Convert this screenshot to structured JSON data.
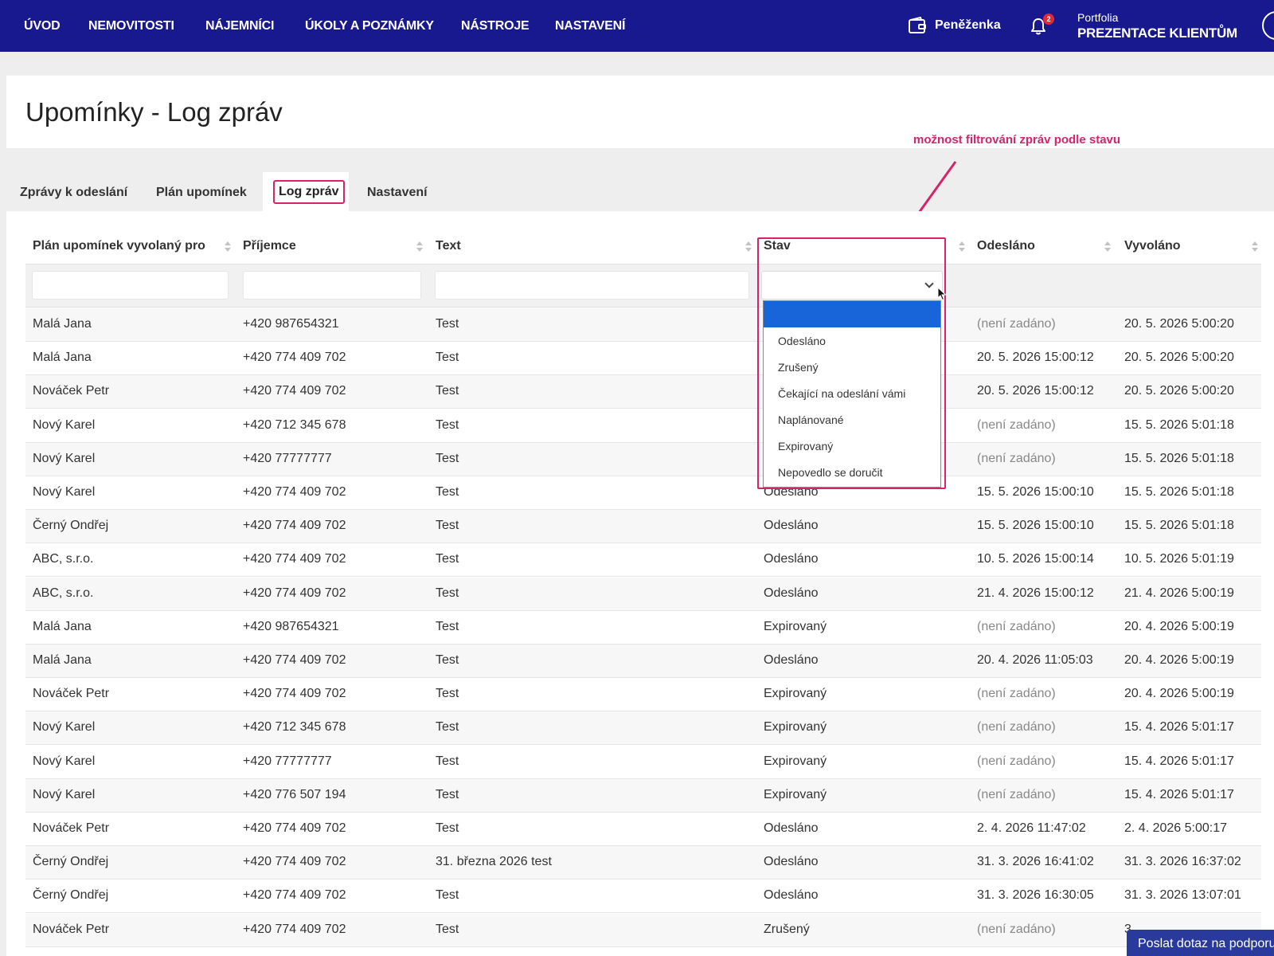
{
  "nav": {
    "items": [
      "ÚVOD",
      "NEMOVITOSTI",
      "NÁJEMNÍCI",
      "ÚKOLY A POZNÁMKY",
      "NÁSTROJE",
      "NASTAVENÍ"
    ],
    "wallet_label": "Peněženka",
    "notification_count": "2",
    "portfolio_label": "Portfolia",
    "portfolio_name": "PREZENTACE KLIENTŮM"
  },
  "page": {
    "title": "Upomínky - Log zpráv"
  },
  "annotation": {
    "text": "možnost filtrování zpráv podle stavu"
  },
  "tabs": [
    "Zprávy k odeslání",
    "Plán upomínek",
    "Log zpráv",
    "Nastavení"
  ],
  "active_tab": "Log zpráv",
  "table": {
    "columns": [
      "Plán upomínek vyvolaný pro",
      "Příjemce",
      "Text",
      "Stav",
      "Odesláno",
      "Vyvoláno"
    ],
    "rows": [
      [
        "Malá Jana",
        "+420 987654321",
        "Test",
        "",
        "(není zadáno)",
        "20. 5. 2026 5:00:20"
      ],
      [
        "Malá Jana",
        "+420 774 409 702",
        "Test",
        "",
        "20. 5. 2026 15:00:12",
        "20. 5. 2026 5:00:20"
      ],
      [
        "Nováček Petr",
        "+420 774 409 702",
        "Test",
        "",
        "20. 5. 2026 15:00:12",
        "20. 5. 2026 5:00:20"
      ],
      [
        "Nový Karel",
        "+420 712 345 678",
        "Test",
        "",
        "(není zadáno)",
        "15. 5. 2026 5:01:18"
      ],
      [
        "Nový Karel",
        "+420 77777777",
        "Test",
        "",
        "(není zadáno)",
        "15. 5. 2026 5:01:18"
      ],
      [
        "Nový Karel",
        "+420 774 409 702",
        "Test",
        "Odesláno",
        "15. 5. 2026 15:00:10",
        "15. 5. 2026 5:01:18"
      ],
      [
        "Černý Ondřej",
        "+420 774 409 702",
        "Test",
        "Odesláno",
        "15. 5. 2026 15:00:10",
        "15. 5. 2026 5:01:18"
      ],
      [
        "ABC, s.r.o.",
        "+420 774 409 702",
        "Test",
        "Odesláno",
        "10. 5. 2026 15:00:14",
        "10. 5. 2026 5:01:19"
      ],
      [
        "ABC, s.r.o.",
        "+420 774 409 702",
        "Test",
        "Odesláno",
        "21. 4. 2026 15:00:12",
        "21. 4. 2026 5:00:19"
      ],
      [
        "Malá Jana",
        "+420 987654321",
        "Test",
        "Expirovaný",
        "(není zadáno)",
        "20. 4. 2026 5:00:19"
      ],
      [
        "Malá Jana",
        "+420 774 409 702",
        "Test",
        "Odesláno",
        "20. 4. 2026 11:05:03",
        "20. 4. 2026 5:00:19"
      ],
      [
        "Nováček Petr",
        "+420 774 409 702",
        "Test",
        "Expirovaný",
        "(není zadáno)",
        "20. 4. 2026 5:00:19"
      ],
      [
        "Nový Karel",
        "+420 712 345 678",
        "Test",
        "Expirovaný",
        "(není zadáno)",
        "15. 4. 2026 5:01:17"
      ],
      [
        "Nový Karel",
        "+420 77777777",
        "Test",
        "Expirovaný",
        "(není zadáno)",
        "15. 4. 2026 5:01:17"
      ],
      [
        "Nový Karel",
        "+420 776 507 194",
        "Test",
        "Expirovaný",
        "(není zadáno)",
        "15. 4. 2026 5:01:17"
      ],
      [
        "Nováček Petr",
        "+420 774 409 702",
        "Test",
        "Odesláno",
        "2. 4. 2026 11:47:02",
        "2. 4. 2026 5:00:17"
      ],
      [
        "Černý Ondřej",
        "+420 774 409 702",
        "31. března 2026 test",
        "Odesláno",
        "31. 3. 2026 16:41:02",
        "31. 3. 2026 16:37:02"
      ],
      [
        "Černý Ondřej",
        "+420 774 409 702",
        "Test",
        "Odesláno",
        "31. 3. 2026 16:30:05",
        "31. 3. 2026 13:07:01"
      ],
      [
        "Nováček Petr",
        "+420 774 409 702",
        "Test",
        "Zrušený",
        "(není zadáno)",
        "3"
      ]
    ]
  },
  "status_filter": {
    "selected": "",
    "options": [
      "",
      "Odesláno",
      "Zrušený",
      "Čekající na odeslání vámi",
      "Naplánované",
      "Expirovaný",
      "Nepovedlo se doručit"
    ]
  },
  "support_button": {
    "label": "Poslat dotaz na podporu"
  },
  "colors": {
    "nav_bg": "#18188f",
    "accent": "#d6246b",
    "selected_option": "#1765d8"
  }
}
